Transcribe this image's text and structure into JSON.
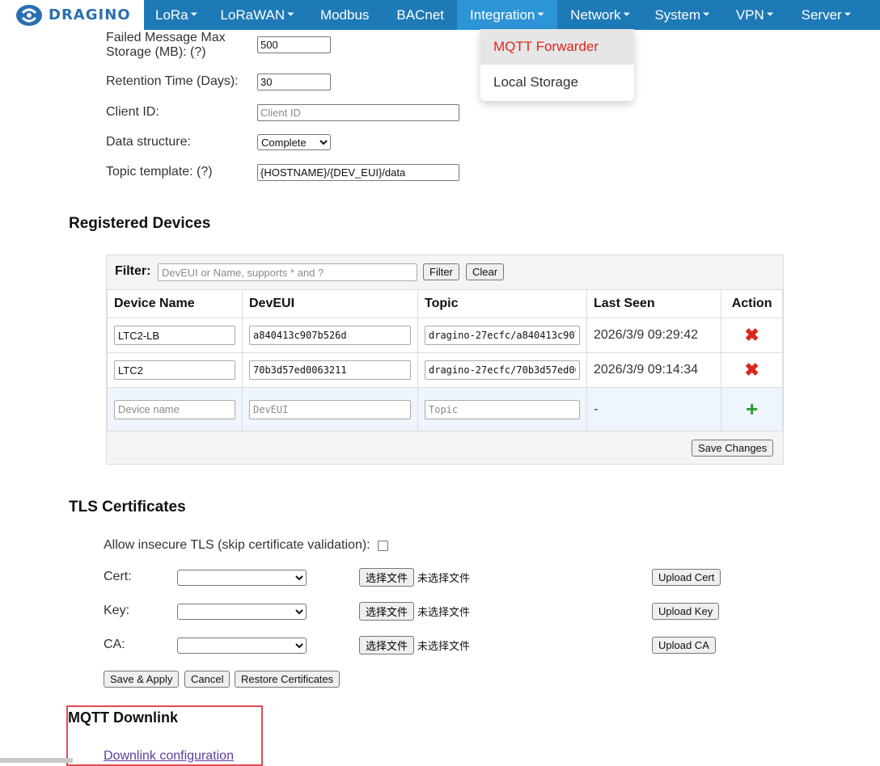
{
  "nav": {
    "logo_text": "DRAGINO",
    "items": [
      {
        "label": "LoRa",
        "caret": "⏷"
      },
      {
        "label": "LoRaWAN",
        "caret": "⏷"
      },
      {
        "label": "Modbus",
        "caret": ""
      },
      {
        "label": "BACnet",
        "caret": ""
      },
      {
        "label": "Integration",
        "caret": "⏷"
      },
      {
        "label": "Network",
        "caret": "⏷"
      },
      {
        "label": "System",
        "caret": "⏷"
      },
      {
        "label": "VPN",
        "caret": "⏷"
      },
      {
        "label": "Server",
        "caret": "⏷"
      }
    ],
    "active_index": 4
  },
  "dropdown": {
    "items": [
      "MQTT Forwarder",
      "Local Storage"
    ],
    "selected_index": 0
  },
  "settings": {
    "failed_storage_label_1": "Failed Message Max",
    "failed_storage_label_2": "Storage (MB): (?)",
    "failed_storage_value": "500",
    "retention_label": "Retention Time (Days):",
    "retention_value": "30",
    "client_id_label": "Client ID:",
    "client_id_placeholder": "Client ID",
    "data_structure_label": "Data structure:",
    "data_structure_value": "Complete",
    "topic_template_label": "Topic template: (?)",
    "topic_template_value": "{HOSTNAME}/{DEV_EUI}/data"
  },
  "devices": {
    "title": "Registered Devices",
    "filter_label": "Filter:",
    "filter_placeholder": "DevEUI or Name, supports * and ?",
    "filter_button": "Filter",
    "clear_button": "Clear",
    "columns": [
      "Device Name",
      "DevEUI",
      "Topic",
      "Last Seen",
      "Action"
    ],
    "rows": [
      {
        "name": "LTC2-LB",
        "deveui": "a840413c907b526d",
        "topic": "dragino-27ecfc/a840413c907",
        "last_seen": "2026/3/9 09:29:42"
      },
      {
        "name": "LTC2",
        "deveui": "70b3d57ed0063211",
        "topic": "dragino-27ecfc/70b3d57ed00",
        "last_seen": "2026/3/9 09:14:34"
      }
    ],
    "new_row": {
      "name_placeholder": "Device name",
      "deveui_placeholder": "DevEUI",
      "topic_placeholder": "Topic",
      "last_seen": "-"
    },
    "save_changes": "Save Changes"
  },
  "tls": {
    "title": "TLS Certificates",
    "insecure_label": "Allow insecure TLS (skip certificate validation):",
    "choose_file": "选择文件",
    "no_file": "未选择文件",
    "cert_label": "Cert:",
    "key_label": "Key:",
    "ca_label": "CA:",
    "upload_cert": "Upload Cert",
    "upload_key": "Upload Key",
    "upload_ca": "Upload CA",
    "save_apply": "Save & Apply",
    "cancel": "Cancel",
    "restore": "Restore Certificates"
  },
  "downlink": {
    "title": "MQTT Downlink",
    "link": "Downlink configuration"
  }
}
